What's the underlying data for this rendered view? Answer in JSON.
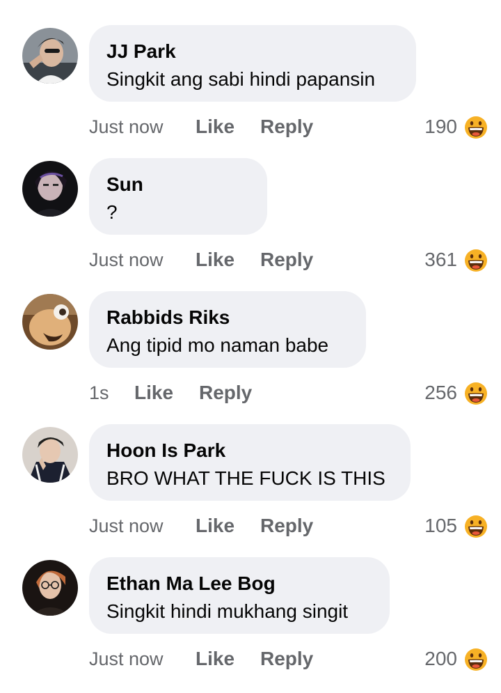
{
  "comments": [
    {
      "author": "JJ Park",
      "text": "Singkit ang sabi hindi papansin",
      "time": "Just now",
      "like_label": "Like",
      "reply_label": "Reply",
      "reaction_count": "190",
      "reaction_icon": "haha-emoji-icon"
    },
    {
      "author": "Sun",
      "text": "?",
      "time": "Just now",
      "like_label": "Like",
      "reply_label": "Reply",
      "reaction_count": "361",
      "reaction_icon": "haha-emoji-icon"
    },
    {
      "author": "Rabbids Riks",
      "text": "Ang tipid mo naman babe",
      "time": "1s",
      "like_label": "Like",
      "reply_label": "Reply",
      "reaction_count": "256",
      "reaction_icon": "haha-emoji-icon"
    },
    {
      "author": "Hoon Is Park",
      "text": "BRO WHAT THE FUCK IS THIS",
      "time": "Just now",
      "like_label": "Like",
      "reply_label": "Reply",
      "reaction_count": "105",
      "reaction_icon": "haha-emoji-icon"
    },
    {
      "author": "Ethan Ma Lee Bog",
      "text": "Singkit hindi mukhang singit",
      "time": "Just now",
      "like_label": "Like",
      "reply_label": "Reply",
      "reaction_count": "200",
      "reaction_icon": "haha-emoji-icon"
    }
  ],
  "colors": {
    "bubble": "#eff0f4",
    "text": "#050505",
    "secondary_text": "#65676b",
    "reaction_face": "#f7b125"
  }
}
